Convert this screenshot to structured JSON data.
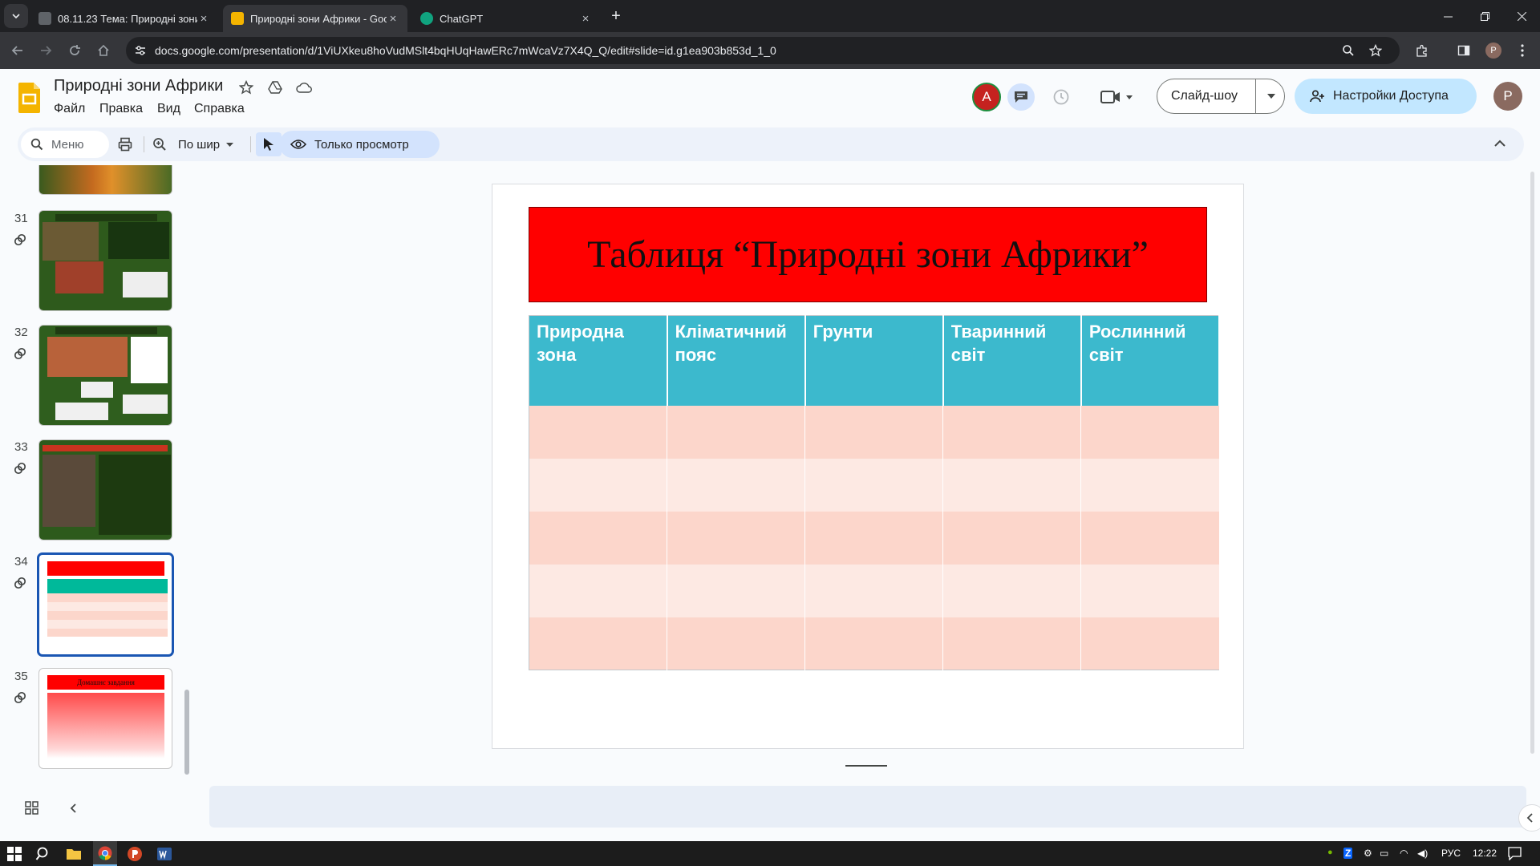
{
  "browser": {
    "tabs": [
      {
        "title": "08.11.23 Тема: Природні зони",
        "active": false
      },
      {
        "title": "Природні зони Африки - Goo",
        "active": true
      },
      {
        "title": "ChatGPT",
        "active": false
      }
    ],
    "url": "docs.google.com/presentation/d/1ViUXkeu8hoVudMSlt4bqHUqHawERc7mWcaVz7X4Q_Q/edit#slide=id.g1ea903b853d_1_0"
  },
  "doc": {
    "title": "Природні зони Африки",
    "menus": [
      "Файл",
      "Правка",
      "Вид",
      "Справка"
    ],
    "avatar_letter": "A",
    "profile_letter": "P",
    "slideshow_label": "Слайд-шоу",
    "share_label": "Настройки Доступа"
  },
  "toolbar": {
    "search_placeholder": "Меню",
    "zoom_label": "По шир",
    "view_only_label": "Только просмотр"
  },
  "filmstrip": {
    "slides": [
      {
        "number": "31",
        "selected": false
      },
      {
        "number": "32",
        "selected": false
      },
      {
        "number": "33",
        "selected": false
      },
      {
        "number": "34",
        "selected": true
      },
      {
        "number": "35",
        "selected": false
      }
    ],
    "thumb35_title": "Домашнє завдання"
  },
  "slide": {
    "title": "Таблиця “Природні зони Африки”",
    "table": {
      "headers": [
        "Природна зона",
        "Кліматичний пояс",
        "Грунти",
        "Тваринний світ",
        "Рослинний світ"
      ],
      "rows": [
        [
          "",
          "",
          "",
          "",
          ""
        ],
        [
          "",
          "",
          "",
          "",
          ""
        ],
        [
          "",
          "",
          "",
          "",
          ""
        ],
        [
          "",
          "",
          "",
          "",
          ""
        ],
        [
          "",
          "",
          "",
          "",
          ""
        ]
      ]
    }
  },
  "taskbar": {
    "language": "РУС",
    "time": "12:22"
  },
  "colors": {
    "banner": "#ff0000",
    "table_header": "#3cb9cd",
    "row_odd": "#fcd6cb",
    "row_even": "#fde9e3",
    "accent": "#1a56b3",
    "share_button": "#c2e7ff"
  }
}
